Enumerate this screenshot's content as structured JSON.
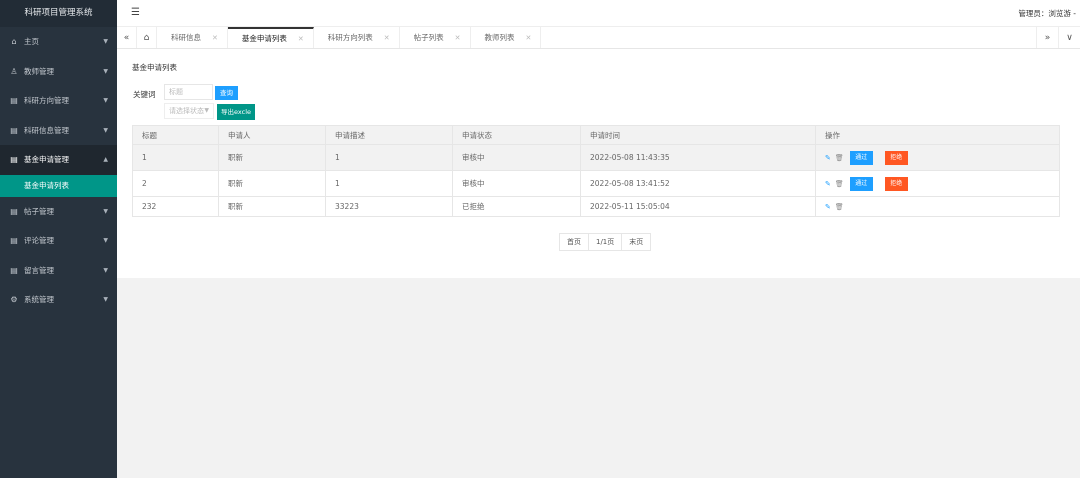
{
  "app": {
    "title": "科研项目管理系统"
  },
  "header": {
    "menu_toggle_icon": "hamburger-icon",
    "admin_text": "管理员：浏览游 -"
  },
  "sidebar": {
    "items": [
      {
        "icon": "home-icon",
        "label": "主页"
      },
      {
        "icon": "user-icon",
        "label": "教师管理"
      },
      {
        "icon": "grid-icon",
        "label": "科研方向管理"
      },
      {
        "icon": "grid-icon",
        "label": "科研信息管理"
      },
      {
        "icon": "grid-icon",
        "label": "基金申请管理",
        "open": true
      },
      {
        "icon": "grid-icon",
        "label": "帖子管理"
      },
      {
        "icon": "grid-icon",
        "label": "评论管理"
      },
      {
        "icon": "grid-icon",
        "label": "留言管理"
      },
      {
        "icon": "gear-icon",
        "label": "系统管理"
      }
    ],
    "sub_item": "基金申请列表"
  },
  "tabs": [
    {
      "label": "科研信息",
      "active": false
    },
    {
      "label": "基金申请列表",
      "active": true
    },
    {
      "label": "科研方向列表",
      "active": false
    },
    {
      "label": "帖子列表",
      "active": false
    },
    {
      "label": "教师列表",
      "active": false
    }
  ],
  "content": {
    "page_title": "基金申请列表",
    "keyword_label": "关键词",
    "keyword_placeholder": "标题",
    "search_button": "查询",
    "status_select": "请选择状态",
    "export_button": "导出excle"
  },
  "table": {
    "headers": [
      "标题",
      "申请人",
      "申请描述",
      "申请状态",
      "申请时间",
      "操作"
    ],
    "rows": [
      {
        "title": "1",
        "applicant": "职新",
        "desc": "1",
        "status": "审核中",
        "time": "2022-05-08 11:43:35",
        "actions": [
          "edit-icon",
          "delete-icon",
          "通过",
          "拒绝"
        ]
      },
      {
        "title": "2",
        "applicant": "职新",
        "desc": "1",
        "status": "审核中",
        "time": "2022-05-08 13:41:52",
        "actions": [
          "edit-icon",
          "delete-icon",
          "通过",
          "拒绝"
        ]
      },
      {
        "title": "232",
        "applicant": "职新",
        "desc": "33223",
        "status": "已拒绝",
        "time": "2022-05-11 15:05:04",
        "actions": [
          "edit-icon",
          "delete-icon"
        ]
      }
    ],
    "pass_label": "通过",
    "reject_label": "拒绝"
  },
  "pager": {
    "first": "首页",
    "info": "1/1页",
    "last": "末页"
  }
}
